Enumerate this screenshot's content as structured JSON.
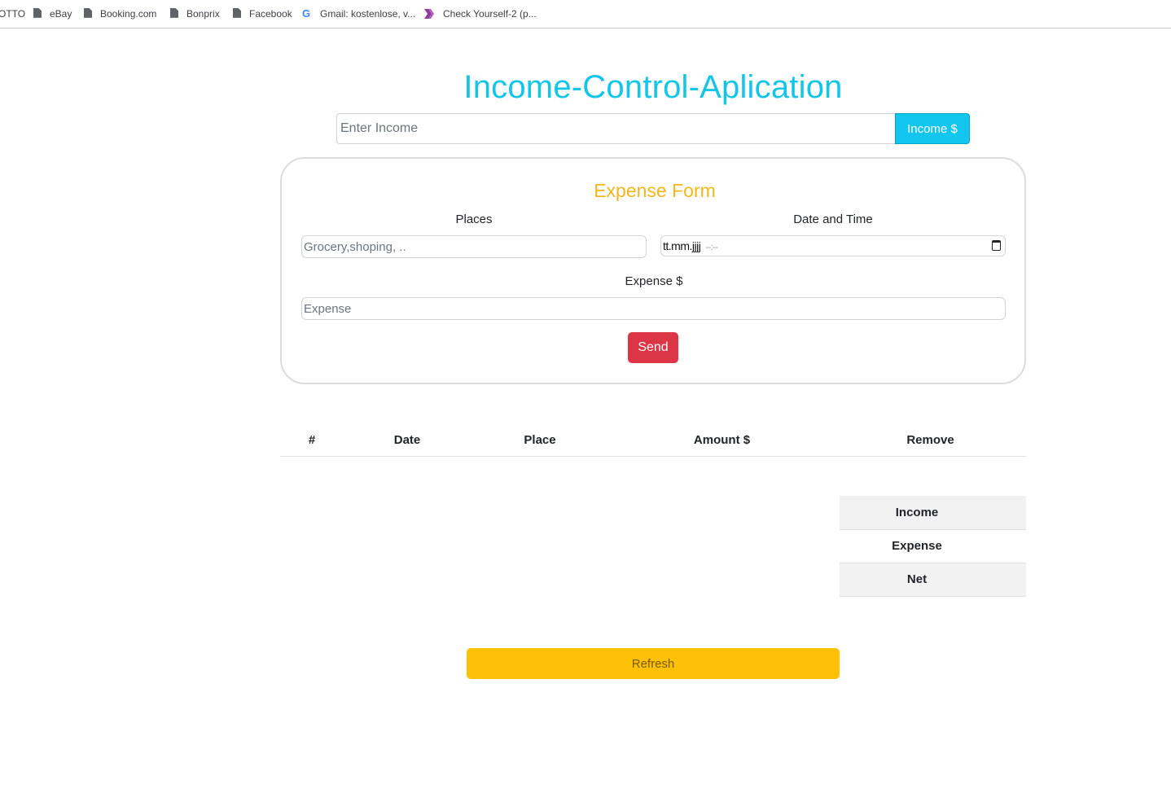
{
  "bookmarks": [
    {
      "label": "OTTO",
      "icon": "none"
    },
    {
      "label": "eBay",
      "icon": "document-icon"
    },
    {
      "label": "Booking.com",
      "icon": "document-icon"
    },
    {
      "label": "Bonprix",
      "icon": "document-icon"
    },
    {
      "label": "Facebook",
      "icon": "document-icon"
    },
    {
      "label": "Gmail: kostenlose, v...",
      "icon": "google-icon"
    },
    {
      "label": "Check Yourself-2 (p...",
      "icon": "chevron-icon"
    }
  ],
  "app": {
    "title": "Income-Control-Aplication"
  },
  "income": {
    "placeholder": "Enter Income",
    "value": "",
    "button_label": "Income $"
  },
  "expense_form": {
    "title": "Expense Form",
    "places_label": "Places",
    "places_placeholder": "Grocery,shoping, ..",
    "datetime_label": "Date and Time",
    "datetime_value": "tt.mm.jjjj",
    "datetime_time": "--:--",
    "expense_label": "Expense $",
    "expense_placeholder": "Expense",
    "send_label": "Send"
  },
  "expense_table": {
    "columns": [
      "#",
      "Date",
      "Place",
      "Amount $",
      "Remove"
    ],
    "rows": []
  },
  "summary": {
    "rows": [
      "Income",
      "Expense",
      "Net"
    ]
  },
  "refresh_label": "Refresh",
  "colors": {
    "title": "#13c6e7",
    "form_title": "#f6b61e",
    "income_button": "#13c6ef",
    "send_button": "#dc3545",
    "refresh_button": "#ffc107"
  }
}
